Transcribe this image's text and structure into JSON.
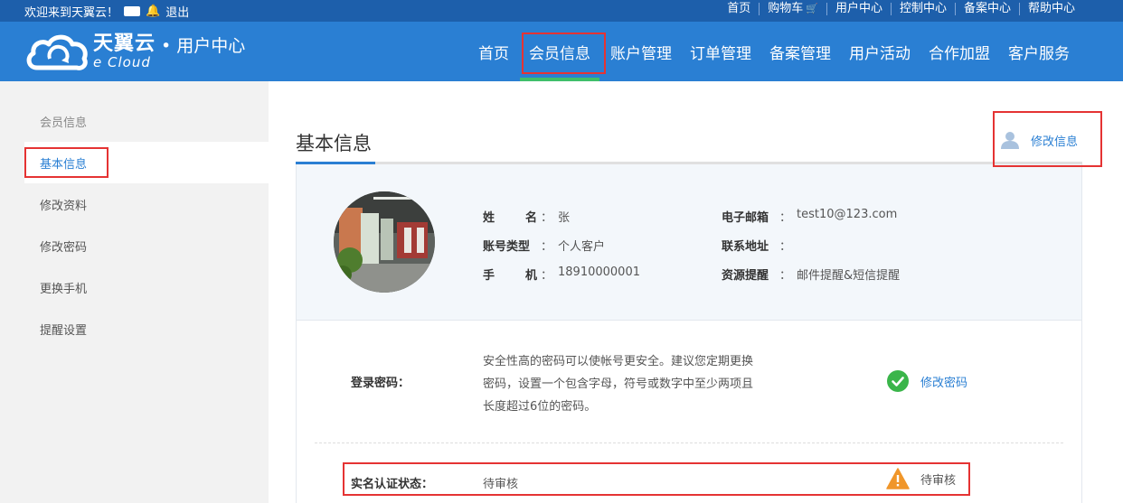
{
  "topbar": {
    "welcome": "欢迎来到天翼云！",
    "logout": "退出",
    "links": [
      "首页",
      "购物车",
      "用户中心",
      "控制中心",
      "备案中心",
      "帮助中心"
    ]
  },
  "header": {
    "brand_cn": "天翼云",
    "brand_en": "e Cloud",
    "subtitle": "• 用户中心",
    "nav": [
      "首页",
      "会员信息",
      "账户管理",
      "订单管理",
      "备案管理",
      "用户活动",
      "合作加盟",
      "客户服务"
    ],
    "active_nav": "会员信息"
  },
  "sidebar": {
    "title": "会员信息",
    "items": [
      "基本信息",
      "修改资料",
      "修改密码",
      "更换手机",
      "提醒设置"
    ],
    "active": "基本信息"
  },
  "content": {
    "title": "基本信息",
    "edit_link": "修改信息",
    "fields": {
      "name_label_a": "姓",
      "name_label_b": "名",
      "name": "张",
      "account_type_label": "账号类型",
      "account_type": "个人客户",
      "phone_label_a": "手",
      "phone_label_b": "机",
      "phone": "18910000001",
      "email_label": "电子邮箱",
      "email": "test10@123.com",
      "address_label": "联系地址",
      "address": "",
      "resource_label": "资源提醒",
      "resource": "邮件提醒&短信提醒",
      "separator": "："
    },
    "password": {
      "label": "登录密码：",
      "description_lines": [
        "安全性高的密码可以使帐号更安全。建议您定期更换",
        "密码，设置一个包含字母，符号或数字中至少两项且",
        "长度超过6位的密码。"
      ],
      "action": "修改密码"
    },
    "realname": {
      "label": "实名认证状态：",
      "value": "待审核",
      "status": "待审核"
    }
  },
  "colors": {
    "topbar": "#1d5fab",
    "header": "#2a7fd3",
    "nav_active_underline": "#3fbf6a",
    "highlight": "#e53333",
    "ok_green": "#3ab54a",
    "warn_orange": "#f0962a"
  },
  "icons": [
    "truck-icon",
    "bell-icon",
    "cart-icon",
    "cloud-logo-icon",
    "user-icon",
    "check-circle-icon",
    "warning-icon"
  ]
}
